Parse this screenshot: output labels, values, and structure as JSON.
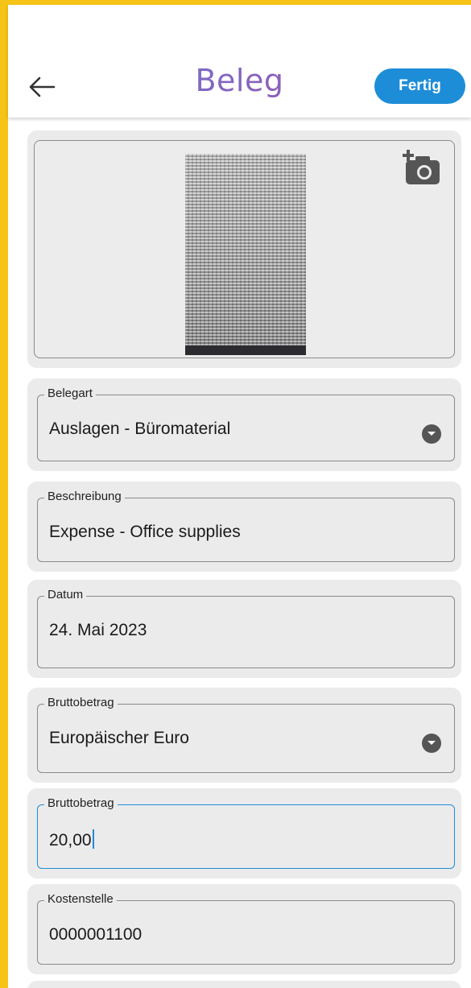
{
  "header": {
    "title": "Beleg",
    "done_label": "Fertig",
    "back_icon": "arrow-left-icon"
  },
  "receipt_image": {
    "camera_icon": "add-camera-icon"
  },
  "fields": {
    "belegart": {
      "label": "Belegart",
      "value": "Auslagen - Büromaterial"
    },
    "beschreibung": {
      "label": "Beschreibung",
      "value": "Expense - Office supplies"
    },
    "datum": {
      "label": "Datum",
      "value": "24. Mai 2023"
    },
    "waehrung": {
      "label": "Bruttobetrag",
      "value": "Europäischer Euro"
    },
    "betrag": {
      "label": "Bruttobetrag",
      "value": "20,00"
    },
    "kostenstelle": {
      "label": "Kostenstelle",
      "value": "0000001100"
    }
  },
  "colors": {
    "accent": "#1E8DD8",
    "frame": "#F5C416",
    "card_bg": "#EBEBEB"
  }
}
